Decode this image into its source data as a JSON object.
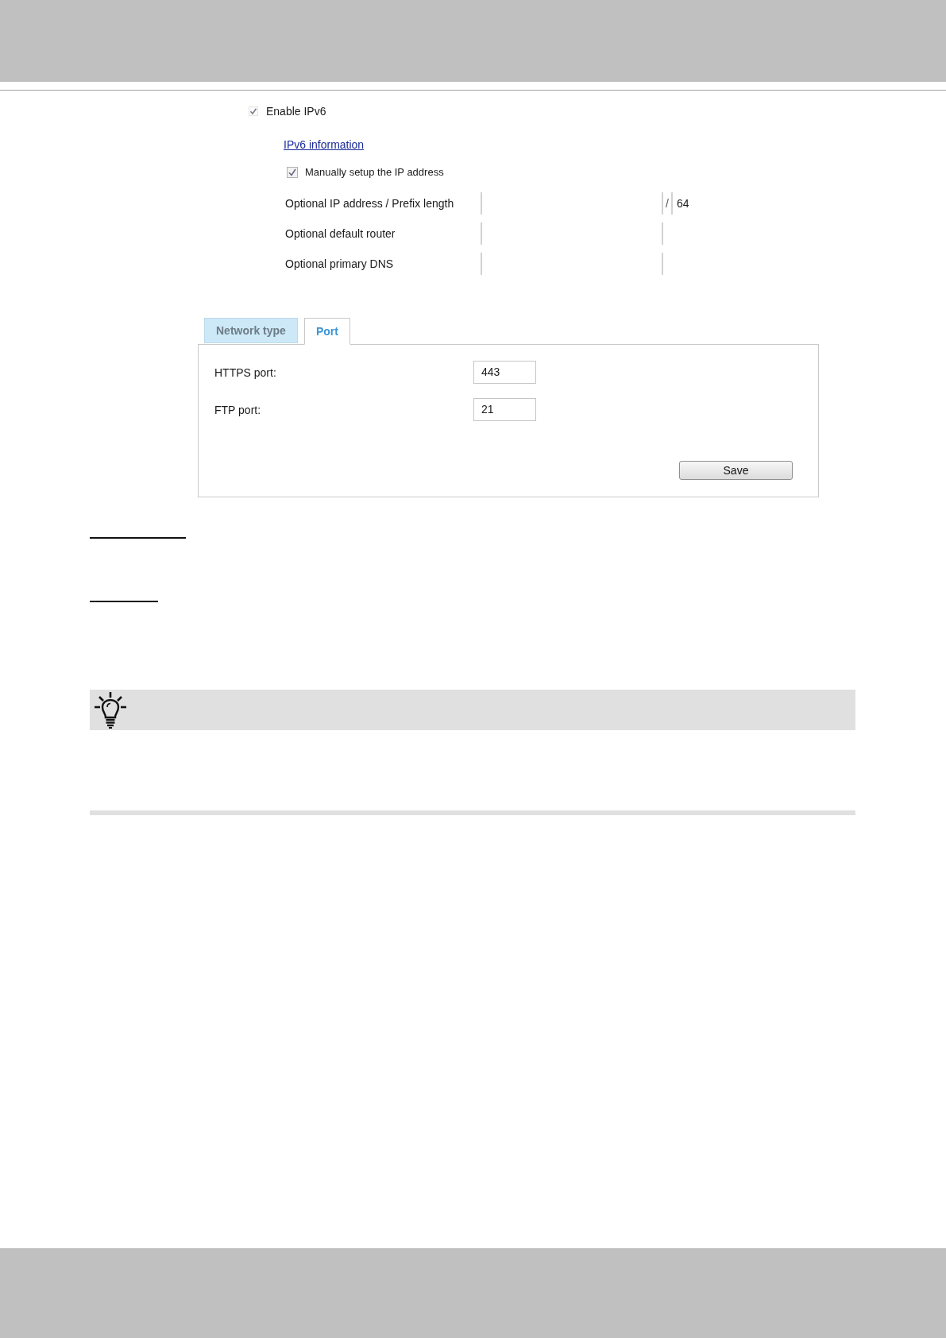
{
  "ipv6": {
    "enable": {
      "label": "Enable IPv6",
      "checked": true
    },
    "info_link": "IPv6 information",
    "manual": {
      "label": "Manually setup the IP address",
      "checked": true
    },
    "fields": [
      {
        "label": "Optional IP address / Prefix length",
        "separator": "/",
        "prefix": "64"
      },
      {
        "label": "Optional default router"
      },
      {
        "label": "Optional primary DNS"
      }
    ]
  },
  "tabs": [
    {
      "label": "Network type",
      "selected": false
    },
    {
      "label": "Port",
      "selected": true
    }
  ],
  "port_panel": {
    "fields": [
      {
        "label": "HTTPS port:",
        "value": "443"
      },
      {
        "label": "FTP port:",
        "value": "21"
      }
    ],
    "save_button": "Save"
  }
}
